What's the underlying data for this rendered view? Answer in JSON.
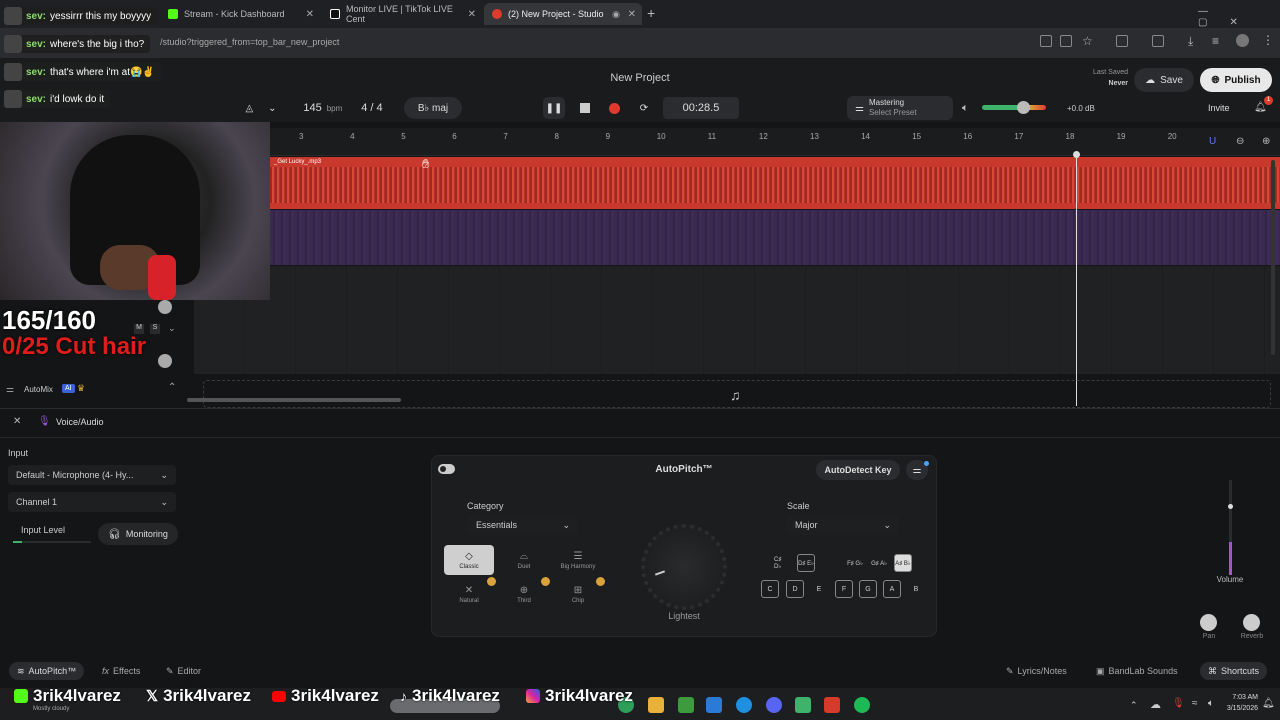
{
  "browser": {
    "tabs": [
      {
        "label": "sev: yessirrr this my boyyyy"
      },
      {
        "label": "Stream - Kick Dashboard"
      },
      {
        "label": "Monitor LIVE | TikTok LIVE Cent"
      },
      {
        "label": "(2) New Project - Studio"
      }
    ],
    "url": "/studio?triggered_from=top_bar_new_project"
  },
  "chat": [
    {
      "user": "sev:",
      "text": "yessirrr this my boyyyy"
    },
    {
      "user": "sev:",
      "text": "where's the big i tho?"
    },
    {
      "user": "sev:",
      "text": "that's where i'm at😭✌️"
    },
    {
      "user": "sev:",
      "text": "i'd lowk do it"
    }
  ],
  "header": {
    "project_title": "New Project",
    "bpm": "145",
    "bpm_unit": "bpm",
    "time_sig": "4 / 4",
    "key": "B♭ maj",
    "time": "00:28.5",
    "mastering_title": "Mastering",
    "mastering_sub": "Select Preset",
    "volume_db": "+0.0 dB",
    "last_saved_label": "Last Saved",
    "last_saved_value": "Never",
    "save": "Save",
    "publish": "Publish",
    "invite": "Invite",
    "notif_count": "1"
  },
  "ruler": [
    "3",
    "4",
    "5",
    "6",
    "7",
    "8",
    "9",
    "10",
    "11",
    "12",
    "13",
    "14",
    "15",
    "16",
    "17",
    "18",
    "19",
    "20"
  ],
  "track": {
    "clip_name": "_Get Lucky_.mp3",
    "mute": "M",
    "solo": "S"
  },
  "overlay": {
    "goal1": "165/160",
    "goal2": "0/25 Cut hair"
  },
  "automix": {
    "label": "AutoMix",
    "badge": "AI"
  },
  "panel": {
    "track_name": "Voice/Audio",
    "input_label": "Input",
    "input_value": "Default - Microphone (4- Hy...",
    "channel_value": "Channel 1",
    "input_level": "Input Level",
    "monitoring": "Monitoring"
  },
  "autopitch": {
    "title": "AutoPitch™",
    "autodetect": "AutoDetect Key",
    "category_label": "Category",
    "category_value": "Essentials",
    "scale_label": "Scale",
    "scale_value": "Major",
    "knob_label": "Lightest",
    "presets": [
      "Classic",
      "Duet",
      "Big Harmony",
      "Natural",
      "Third",
      "Chip"
    ],
    "sharps": [
      "C♯ D♭",
      "D♯ E♭",
      "F♯ G♭",
      "G♯ A♭",
      "A♯ B♭"
    ],
    "naturals": [
      "C",
      "D",
      "E",
      "F",
      "G",
      "A",
      "B"
    ]
  },
  "mixer": {
    "volume": "Volume",
    "pan": "Pan",
    "reverb": "Reverb",
    "volume_level": 0.35
  },
  "footer_tabs": {
    "autopitch": "AutoPitch™",
    "effects": "Effects",
    "editor": "Editor",
    "lyrics": "Lyrics/Notes",
    "sounds": "BandLab Sounds",
    "shortcuts": "Shortcuts"
  },
  "socials": [
    "3rik4lvarez",
    "3rik4lvarez",
    "3rik4lvarez",
    "3rik4lvarez",
    "3rik4lvarez"
  ],
  "taskbar": {
    "weather": "Mostly cloudy",
    "time": "7:03 AM",
    "date": "3/15/2026"
  },
  "colors": {
    "track_red": "#c9382d",
    "track_purple": "#3a2a52",
    "accent_purple": "#9b59d6",
    "record_red": "#e03a2f"
  }
}
